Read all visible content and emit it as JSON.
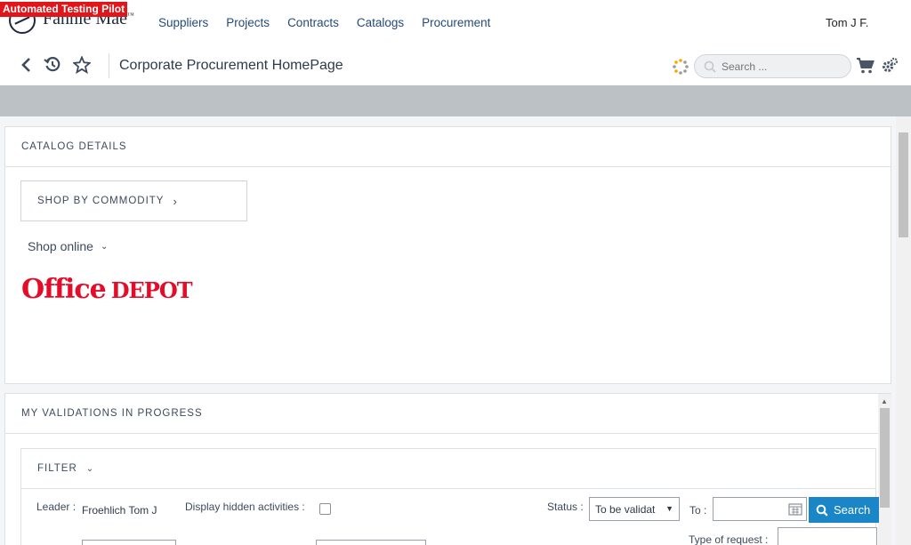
{
  "badge": "Automated Testing Pilot",
  "brand": {
    "name": "Fannie Mae",
    "tm": "™"
  },
  "nav": [
    "Suppliers",
    "Projects",
    "Contracts",
    "Catalogs",
    "Procurement"
  ],
  "user": "Tom J F.",
  "toolbar": {
    "title": "Corporate Procurement HomePage",
    "search_placeholder": "Search ..."
  },
  "catalog": {
    "header": "CATALOG DETAILS",
    "commodity": "SHOP BY COMMODITY",
    "shop_online": "Shop online",
    "logo_word1": "Office",
    "logo_word2": "DEPOT"
  },
  "validations": {
    "header": "MY VALIDATIONS IN PROGRESS",
    "filter": "FILTER",
    "leader_label": "Leader :",
    "leader_value": "Froehlich Tom J",
    "hidden_label": "Display hidden activities :",
    "status_label": "Status :",
    "status_value": "To be validat",
    "to_label": "To :",
    "search_button": "Search",
    "type_label": "Type of request :"
  },
  "colors": {
    "accent": "#1a86c8",
    "nav": "#244a7b",
    "brand_red": "#e30d2a",
    "badge": "#e0161b"
  }
}
